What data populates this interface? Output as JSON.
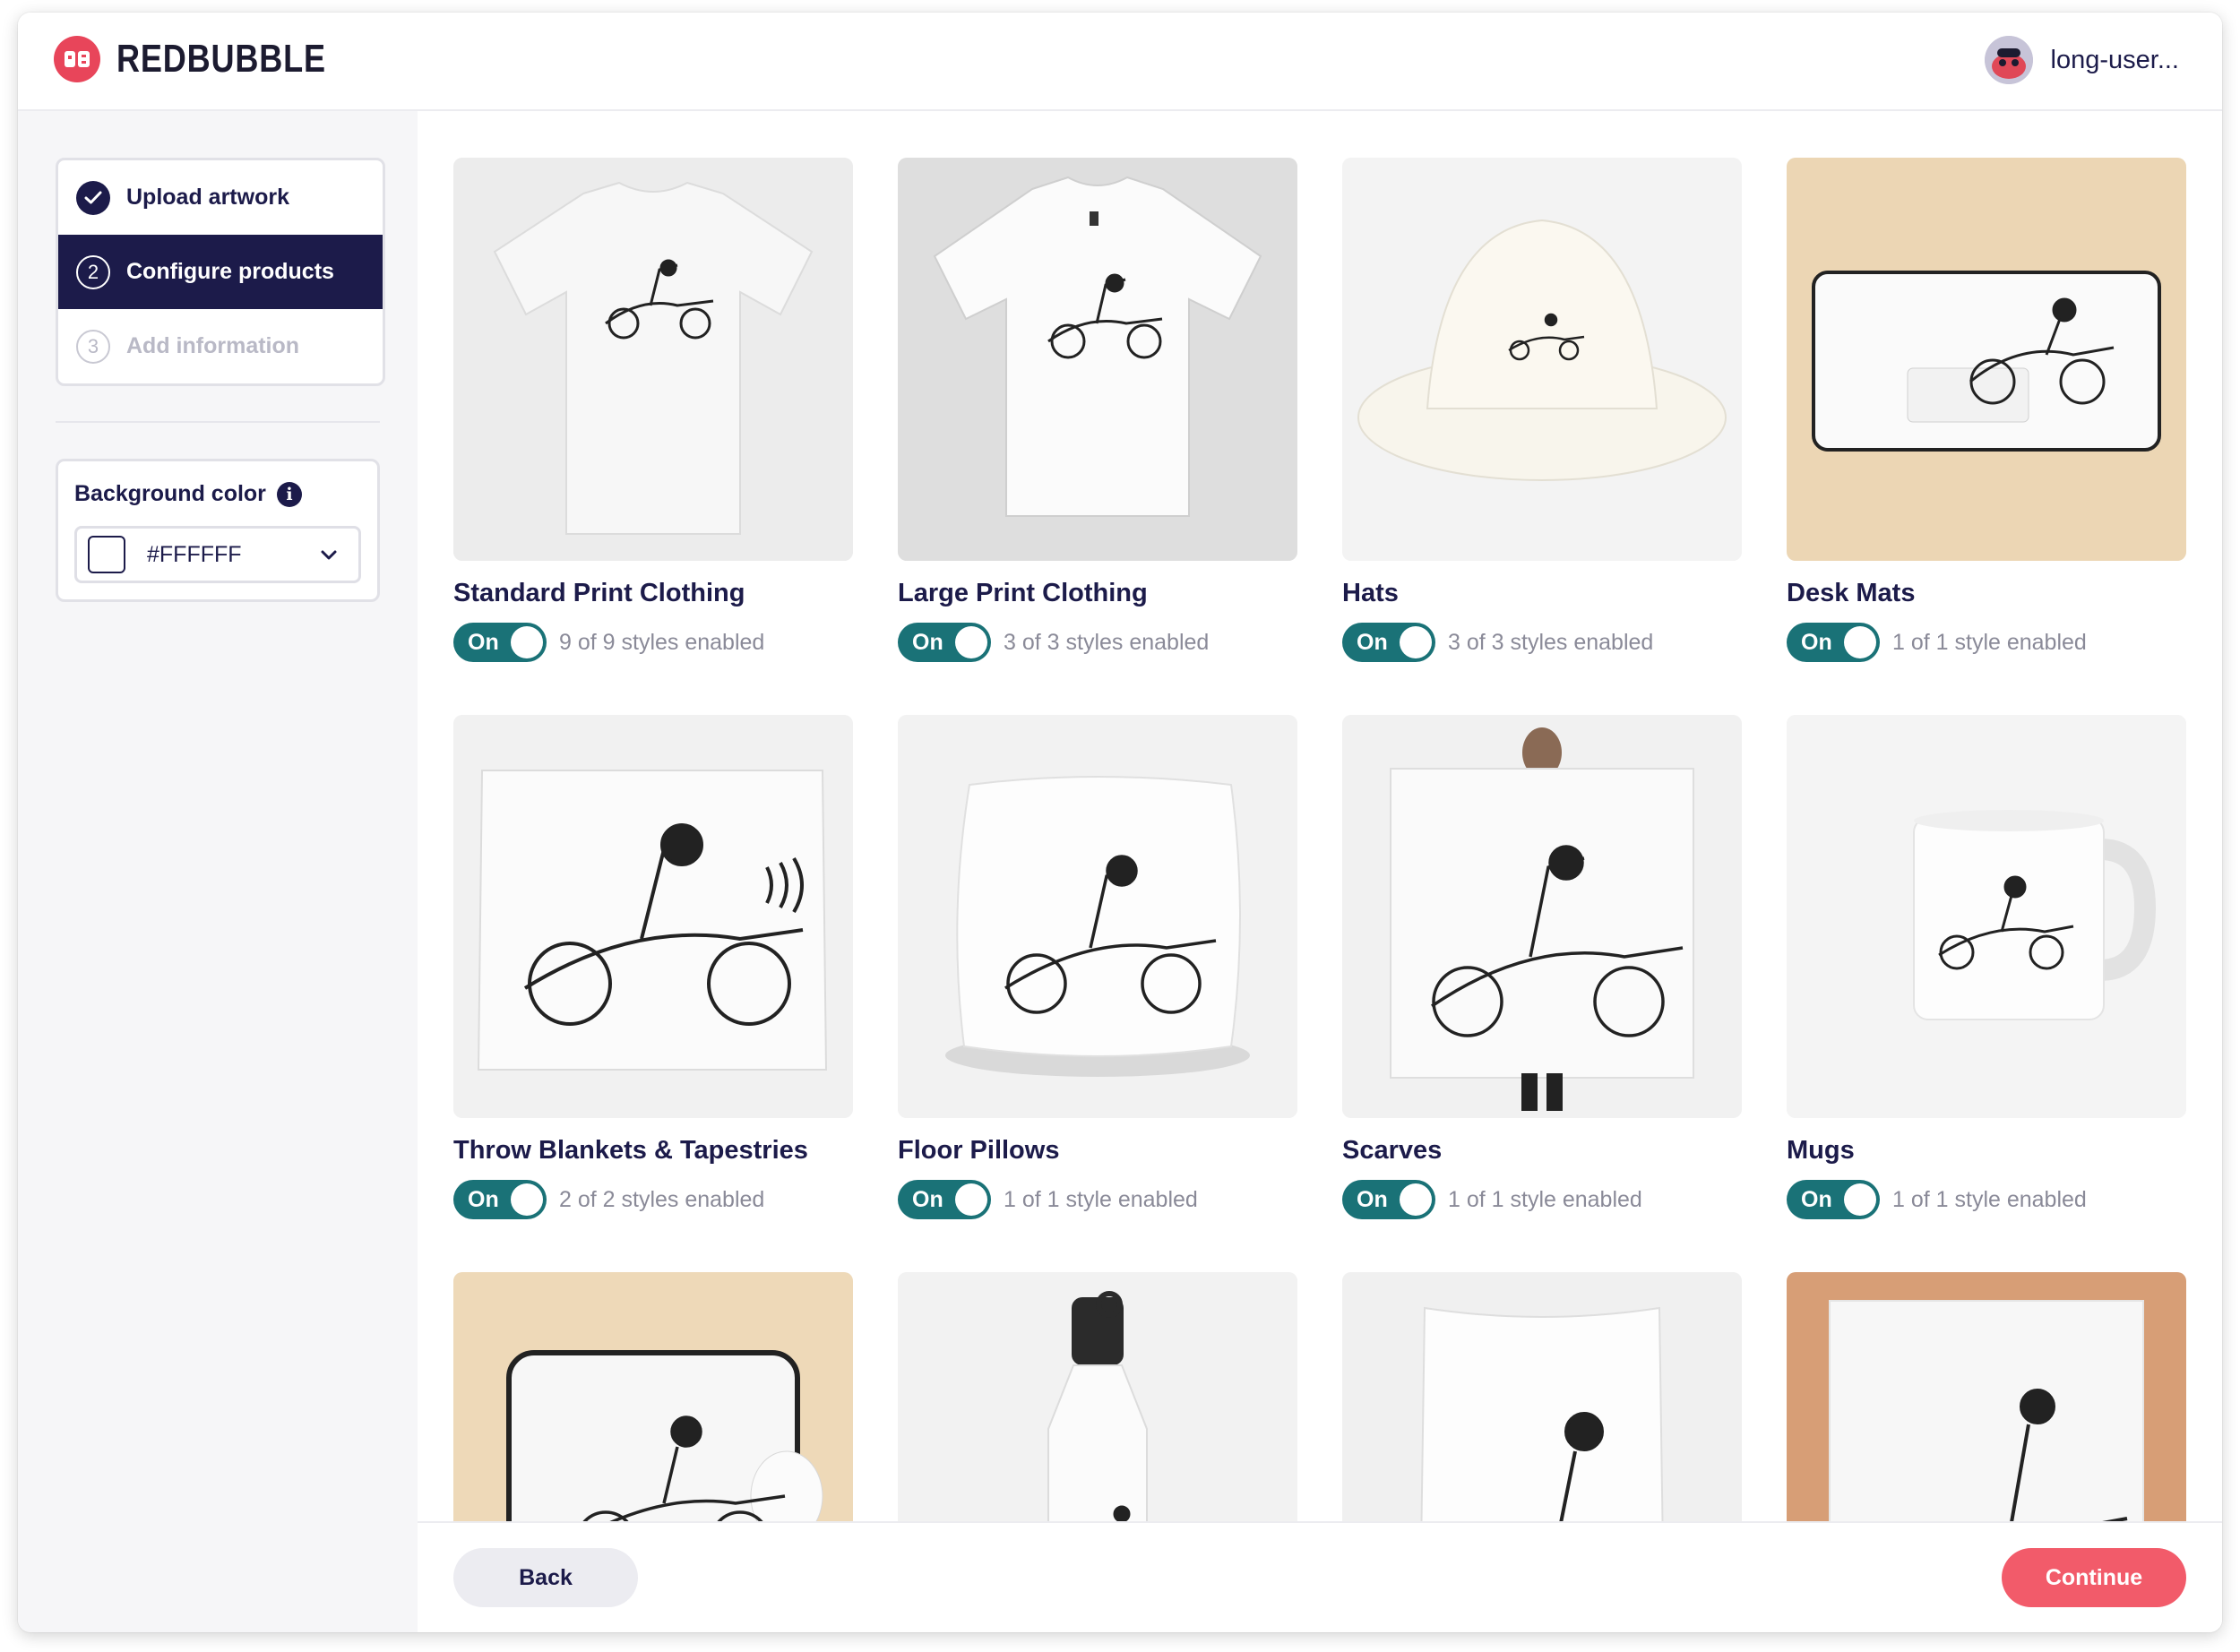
{
  "brand": {
    "name": "REDBUBBLE",
    "accent": "#e8455a"
  },
  "user": {
    "name": "long-user..."
  },
  "steps": [
    {
      "number": "✓",
      "label": "Upload artwork",
      "state": "done"
    },
    {
      "number": "2",
      "label": "Configure products",
      "state": "active"
    },
    {
      "number": "3",
      "label": "Add information",
      "state": "todo"
    }
  ],
  "background_color": {
    "label": "Background color",
    "value": "#FFFFFF"
  },
  "products": [
    {
      "title": "Standard Print Clothing",
      "toggle": "On",
      "styles": "9 of 9 styles enabled",
      "icon": "tshirt-icon"
    },
    {
      "title": "Large Print Clothing",
      "toggle": "On",
      "styles": "3 of 3 styles enabled",
      "icon": "tshirt-icon"
    },
    {
      "title": "Hats",
      "toggle": "On",
      "styles": "3 of 3 styles enabled",
      "icon": "bucket-hat-icon"
    },
    {
      "title": "Desk Mats",
      "toggle": "On",
      "styles": "1 of 1 style enabled",
      "icon": "desk-mat-icon"
    },
    {
      "title": "Throw Blankets & Tapestries",
      "toggle": "On",
      "styles": "2 of 2 styles enabled",
      "icon": "tapestry-icon"
    },
    {
      "title": "Floor Pillows",
      "toggle": "On",
      "styles": "1 of 1 style enabled",
      "icon": "pillow-icon"
    },
    {
      "title": "Scarves",
      "toggle": "On",
      "styles": "1 of 1 style enabled",
      "icon": "scarf-icon"
    },
    {
      "title": "Mugs",
      "toggle": "On",
      "styles": "1 of 1 style enabled",
      "icon": "mug-icon"
    },
    {
      "title": "",
      "toggle": "",
      "styles": "",
      "icon": "mouse-pad-icon"
    },
    {
      "title": "",
      "toggle": "",
      "styles": "",
      "icon": "water-bottle-icon"
    },
    {
      "title": "",
      "toggle": "",
      "styles": "",
      "icon": "duvet-icon"
    },
    {
      "title": "",
      "toggle": "",
      "styles": "",
      "icon": "bath-mat-icon"
    }
  ],
  "footer": {
    "back_label": "Back",
    "continue_label": "Continue"
  },
  "colors": {
    "navy": "#1c1b4a",
    "toggle_on": "#1a7277",
    "continue": "#f25b6a"
  }
}
